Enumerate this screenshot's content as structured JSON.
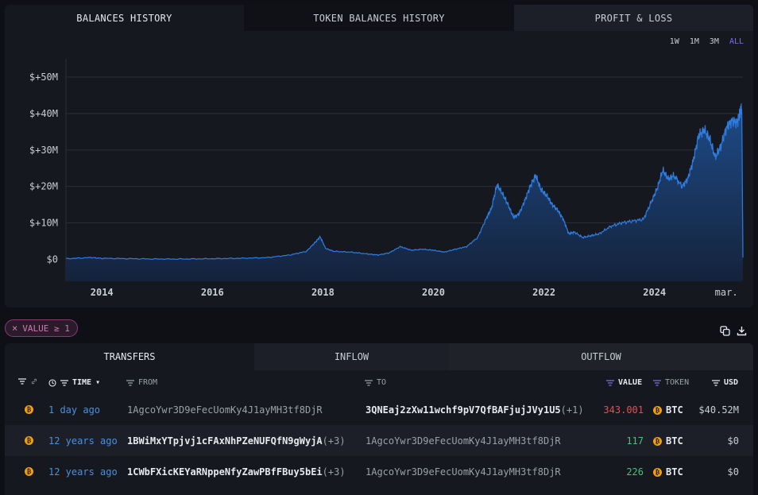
{
  "chart_tabs": [
    "BALANCES HISTORY",
    "TOKEN BALANCES HISTORY",
    "PROFIT & LOSS"
  ],
  "ranges": [
    "1W",
    "1M",
    "3M",
    "ALL"
  ],
  "active_range": "ALL",
  "chart_data": {
    "type": "area",
    "title": "",
    "xlabel": "",
    "ylabel": "",
    "x_ticks": [
      "2014",
      "2016",
      "2018",
      "2020",
      "2022",
      "2024",
      "mar."
    ],
    "y_ticks": [
      "$+50M",
      "$+40M",
      "$+30M",
      "$+20M",
      "$+10M",
      "$0"
    ],
    "ylim_musd": [
      -6,
      55
    ],
    "xlim_year": [
      2013.35,
      2025.6
    ],
    "grid": true,
    "legend": "none",
    "color": "#2f7ce0",
    "series": [
      {
        "x": [
          2013.35,
          2013.8,
          2014.0,
          2014.5,
          2015.0,
          2015.5,
          2016.0,
          2016.5,
          2017.0,
          2017.4,
          2017.7,
          2017.85,
          2017.95,
          2018.05,
          2018.2,
          2018.5,
          2018.8,
          2019.0,
          2019.2,
          2019.4,
          2019.6,
          2019.8,
          2020.0,
          2020.2,
          2020.4,
          2020.6,
          2020.8,
          2020.95,
          2021.05,
          2021.15,
          2021.25,
          2021.35,
          2021.45,
          2021.55,
          2021.65,
          2021.75,
          2021.85,
          2021.95,
          2022.05,
          2022.15,
          2022.25,
          2022.35,
          2022.45,
          2022.55,
          2022.7,
          2022.85,
          2023.0,
          2023.2,
          2023.4,
          2023.6,
          2023.8,
          2023.95,
          2024.05,
          2024.15,
          2024.25,
          2024.35,
          2024.5,
          2024.6,
          2024.7,
          2024.8,
          2024.9,
          2025.0,
          2025.1,
          2025.2,
          2025.3,
          2025.4,
          2025.5,
          2025.55,
          2025.58,
          2025.6
        ],
        "y_musd": [
          0.2,
          0.5,
          0.3,
          0.2,
          0.1,
          0.1,
          0.2,
          0.3,
          0.5,
          1.2,
          2.2,
          4.5,
          6.2,
          3.0,
          2.2,
          2.0,
          1.5,
          1.2,
          1.8,
          3.5,
          2.5,
          2.8,
          2.5,
          2.0,
          2.8,
          3.5,
          6.0,
          11.0,
          14.0,
          20.5,
          18.0,
          15.0,
          11.5,
          12.5,
          16.0,
          20.0,
          23.0,
          19.0,
          17.5,
          15.0,
          13.5,
          11.0,
          7.0,
          7.5,
          6.0,
          6.5,
          7.0,
          9.0,
          10.0,
          10.5,
          11.0,
          16.0,
          19.5,
          24.5,
          22.0,
          23.0,
          20.0,
          22.0,
          27.0,
          34.0,
          35.5,
          33.0,
          28.0,
          31.0,
          36.0,
          38.0,
          37.5,
          40.5,
          41.0,
          0.5
        ]
      }
    ]
  },
  "filter_chip": {
    "label": "VALUE ≥ 1"
  },
  "table_tabs": [
    "TRANSFERS",
    "INFLOW",
    "OUTFLOW"
  ],
  "columns": {
    "time": "TIME",
    "from": "FROM",
    "to": "TO",
    "value": "VALUE",
    "token": "TOKEN",
    "usd": "USD"
  },
  "rows": [
    {
      "time": "1 day ago",
      "from": "1AgcoYwr3D9eFecUomKy4J1ayMH3tf8DjR",
      "from_extra": "",
      "to": "3QNEaj2zXw11wchf9pV7QfBAFjujJVy1U5",
      "to_extra": "(+1)",
      "value": "343.001",
      "token": "BTC",
      "usd": "$40.52M"
    },
    {
      "time": "12 years ago",
      "from": "1BWiMxYTpjvj1cFAxNhPZeNUFQfN9gWyjA",
      "from_extra": "(+3)",
      "to": "1AgcoYwr3D9eFecUomKy4J1ayMH3tf8DjR",
      "to_extra": "",
      "value": "117",
      "token": "BTC",
      "usd": "$0"
    },
    {
      "time": "12 years ago",
      "from": "1CWbFXicKEYaRNppeNfyZawPBfFBuy5bEi",
      "from_extra": "(+3)",
      "to": "1AgcoYwr3D9eFecUomKy4J1ayMH3tf8DjR",
      "to_extra": "",
      "value": "226",
      "token": "BTC",
      "usd": "$0"
    }
  ]
}
